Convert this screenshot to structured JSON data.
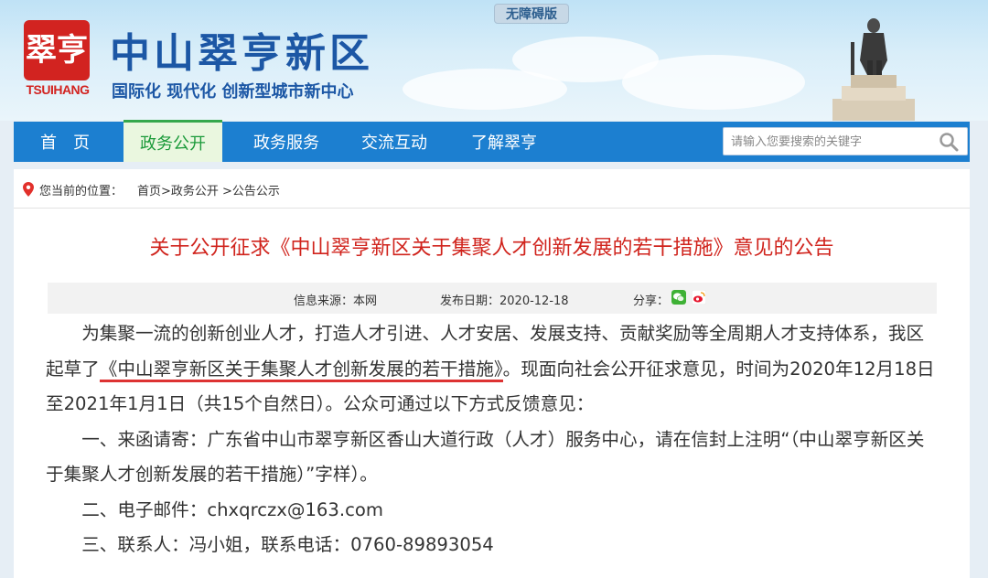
{
  "accessibility_label": "无障碍版",
  "logo": {
    "glyphs": "翠亨",
    "en": "TSUIHANG"
  },
  "site": {
    "title": "中山翠亨新区",
    "slogan": "国际化  现代化  创新型城市新中心"
  },
  "nav": {
    "items": [
      {
        "label": "首　页",
        "active": false
      },
      {
        "label": "政务公开",
        "active": true
      },
      {
        "label": "政务服务",
        "active": false
      },
      {
        "label": "交流互动",
        "active": false
      },
      {
        "label": "了解翠亨",
        "active": false
      }
    ],
    "search_placeholder": "请输入您要搜索的关键字"
  },
  "breadcrumb": {
    "prefix": "您当前的位置：",
    "path": "首页>政务公开 >公告公示"
  },
  "article": {
    "title": "关于公开征求《中山翠亨新区关于集聚人才创新发展的若干措施》意见的公告",
    "meta": {
      "source": "信息来源：本网",
      "date": "发布日期：2020-12-18",
      "share": "分享："
    },
    "para1_a": "为集聚一流的创新创业人才，打造人才引进、人才安居、发展支持、贡献奖励等全周期人才支持体系，我区起草了",
    "para1_doc": "《中山翠亨新区关于集聚人才创新发展的若干措施》",
    "para1_b": "。现面向社会公开征求意见，时间为2020年12月18日至2021年1月1日（共15个自然日）。公众可通过以下方式反馈意见：",
    "para2": "一、来函请寄：广东省中山市翠亨新区香山大道行政（人才）服务中心，请在信封上注明“（中山翠亨新区关于集聚人才创新发展的若干措施）”字样）。",
    "para3": "二、电子邮件：chxqrczx@163.com",
    "para4": "三、联系人：冯小姐，联系电话：0760-89893054"
  },
  "colors": {
    "brand_blue": "#1c57a5",
    "nav_blue": "#1c7fd0",
    "title_red": "#d0231c",
    "logo_red": "#d22320",
    "nav_active_green": "#1b9a3a"
  },
  "icons": [
    "location-pin-icon",
    "search-icon",
    "wechat-icon",
    "weibo-icon",
    "statue-image"
  ]
}
